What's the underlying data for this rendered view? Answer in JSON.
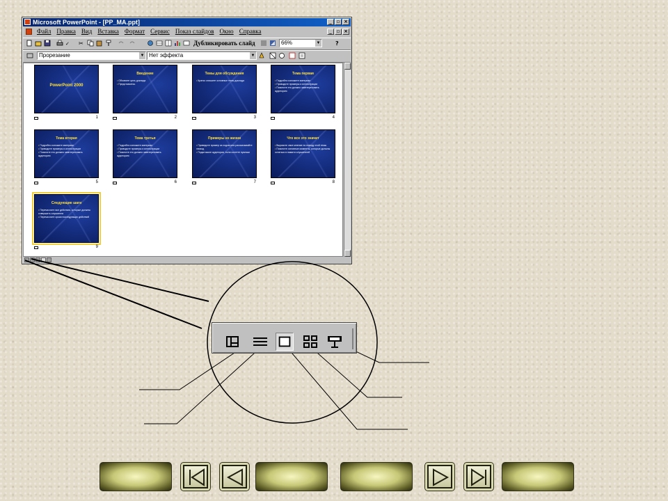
{
  "window": {
    "title": "Microsoft PowerPoint - [PP_MA.ppt]",
    "menu": [
      "Файл",
      "Правка",
      "Вид",
      "Вставка",
      "Формат",
      "Сервис",
      "Показ слайдов",
      "Окно",
      "Справка"
    ],
    "toolbar": {
      "duplicate_label": "Дубликировать слайд",
      "zoom": "66%"
    },
    "transition_effect": "Прорезание",
    "text_effect": "Нет эффекта"
  },
  "slides": [
    {
      "num": "1",
      "title": "PowerPoint 2000",
      "bullets": []
    },
    {
      "num": "2",
      "title": "Введение",
      "bullets": [
        "Объявите цель доклада",
        "Представьтесь"
      ]
    },
    {
      "num": "3",
      "title": "Темы для обсуждения",
      "bullets": [
        "Кратко опишите основные темы доклада"
      ]
    },
    {
      "num": "4",
      "title": "Тема первая",
      "bullets": [
        "Подробно изложите материал",
        "Приводите примеры и иллюстрации",
        "Поясните это должно заинтересовать аудиторию"
      ]
    },
    {
      "num": "5",
      "title": "Тема вторая",
      "bullets": [
        "Подробно изложите материал",
        "Приводите примеры и иллюстрации",
        "Поясните это должно заинтересовать аудиторию"
      ]
    },
    {
      "num": "6",
      "title": "Тема третья",
      "bullets": [
        "Подробно изложите материал",
        "Приводите примеры и иллюстрации",
        "Поясните это должно заинтересовать аудиторию"
      ]
    },
    {
      "num": "7",
      "title": "Примеры из жизни",
      "bullets": [
        "Приведите пример за ходом или рассказывайте эпизод",
        "Подытожьте аудитории, если сочтете нужным"
      ]
    },
    {
      "num": "8",
      "title": "Что все это значит",
      "bullets": [
        "Выразите свое мнение по поводу этой темы",
        "Поясните основные моменты, которые должны остаться в памяти слушателей"
      ]
    },
    {
      "num": "9",
      "title": "Следующие шаги",
      "bullets": [
        "Перечислите все действия, которые должны совершить слушатели",
        "Перечислите сроки последующих действий"
      ]
    }
  ],
  "view_buttons": [
    "normal-view",
    "outline-view",
    "slide-view",
    "slide-sorter-view",
    "slide-show"
  ],
  "nav_buttons": [
    "blank",
    "first",
    "previous",
    "blank",
    "blank",
    "next",
    "last",
    "blank"
  ]
}
